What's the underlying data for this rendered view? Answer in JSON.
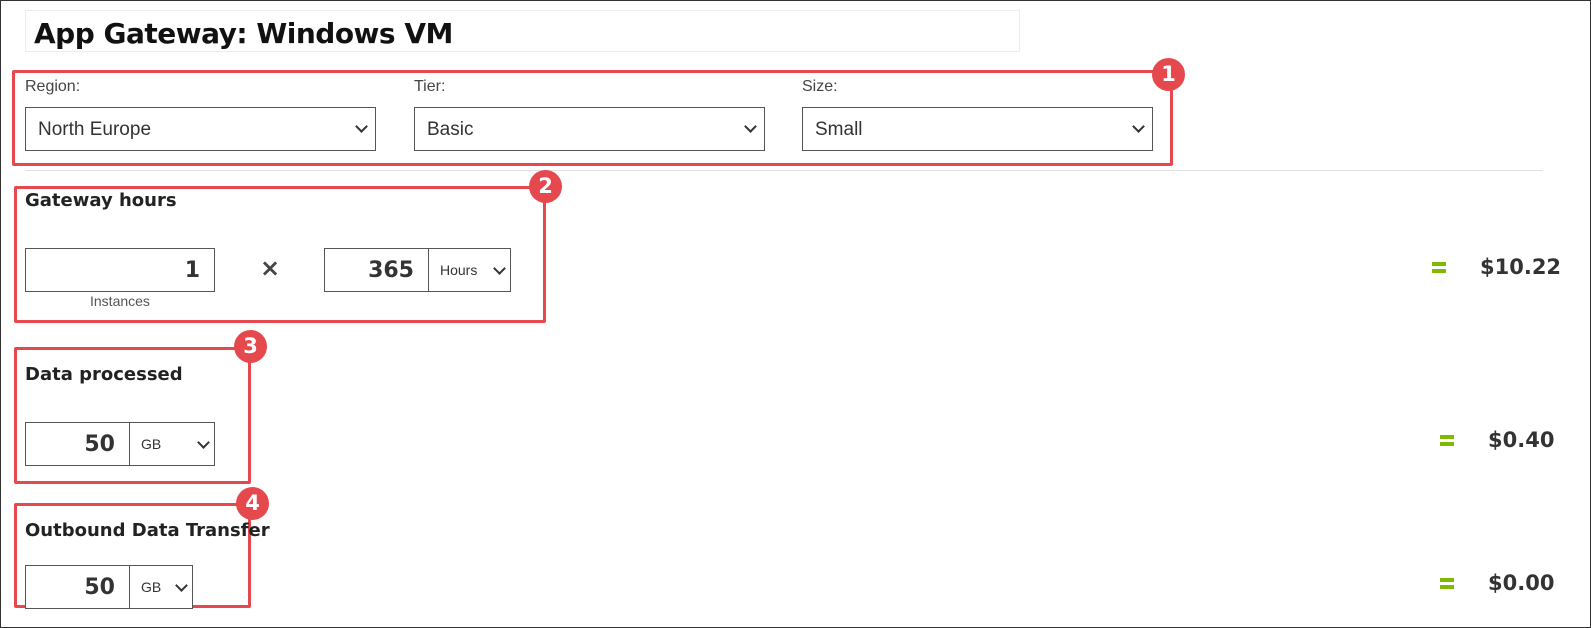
{
  "title": "App Gateway: Windows VM",
  "config": {
    "region": {
      "label": "Region:",
      "value": "North Europe"
    },
    "tier": {
      "label": "Tier:",
      "value": "Basic"
    },
    "size": {
      "label": "Size:",
      "value": "Small"
    }
  },
  "badges": [
    "1",
    "2",
    "3",
    "4"
  ],
  "gateway_hours": {
    "title": "Gateway hours",
    "instances": "1",
    "instances_label": "Instances",
    "multiplier": "×",
    "hours": "365",
    "hours_unit": "Hours",
    "total": "$10.22"
  },
  "data_processed": {
    "title": "Data processed",
    "amount": "50",
    "unit": "GB",
    "total": "$0.40"
  },
  "outbound": {
    "title": "Outbound Data Transfer",
    "amount": "50",
    "unit": "GB",
    "total": "$0.00"
  },
  "colors": {
    "highlight": "#e5484d",
    "equals": "#7fba00"
  },
  "icons": {
    "dropdown": "chevron-down-icon",
    "equals": "equals-icon",
    "multiply": "multiply-icon"
  }
}
